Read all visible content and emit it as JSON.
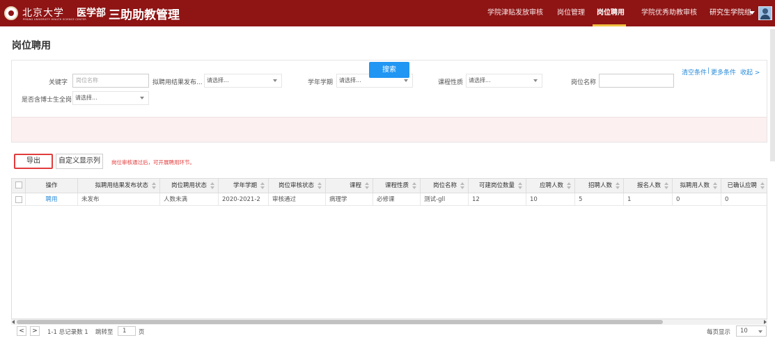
{
  "header": {
    "logo_cn": "北京大学",
    "logo_en": "PEKING UNIVERSITY HEALTH SCIENCE CENTER",
    "logo_dept": "医学部",
    "app_title": "三助助教管理",
    "nav": [
      {
        "label": "学院津贴发放审核"
      },
      {
        "label": "岗位管理"
      },
      {
        "label": "岗位聘用"
      },
      {
        "label": "学院优秀助教审核"
      }
    ],
    "active_nav": "岗位聘用",
    "role": "研究生学院组"
  },
  "page": {
    "title": "岗位聘用"
  },
  "filters": {
    "keyword_label": "关键字",
    "keyword_placeholder": "岗位名称",
    "result_label": "拟聘用结果发布...",
    "result_value": "请选择...",
    "term_label": "学年学期",
    "term_value": "请选择...",
    "course_type_label": "课程性质",
    "course_type_value": "请选择...",
    "post_name_label": "岗位名称",
    "post_name_value": "",
    "phd_label": "是否含博士生全岗",
    "phd_value": "请选择...",
    "search_label": "搜索",
    "clear_label": "清空条件",
    "more_label": "更多条件",
    "collapse_label": "收起 >"
  },
  "toolbar": {
    "export_label": "导出",
    "custom_columns_label": "自定义显示列",
    "hint": "岗位审核通过后，可开展聘用环节。"
  },
  "table": {
    "columns": [
      "操作",
      "拟聘用结果发布状态",
      "岗位聘用状态",
      "学年学期",
      "岗位审核状态",
      "课程",
      "课程性质",
      "岗位名称",
      "可建岗位数量",
      "应聘人数",
      "招聘人数",
      "报名人数",
      "拟聘用人数",
      "已确认应聘"
    ],
    "rows": [
      {
        "action": "聘用",
        "cells": [
          "未发布",
          "人数未满",
          "2020-2021-2",
          "审核通过",
          "病理学",
          "必修课",
          "测试-gll",
          "12",
          "10",
          "5",
          "1",
          "0",
          "0"
        ]
      }
    ]
  },
  "pagination": {
    "prev": "<",
    "next": ">",
    "summary": "1-1 总记录数 1",
    "goto_label": "跳转至",
    "page_value": "1",
    "page_unit": "页",
    "page_size_label": "每页显示",
    "page_size": "10"
  }
}
